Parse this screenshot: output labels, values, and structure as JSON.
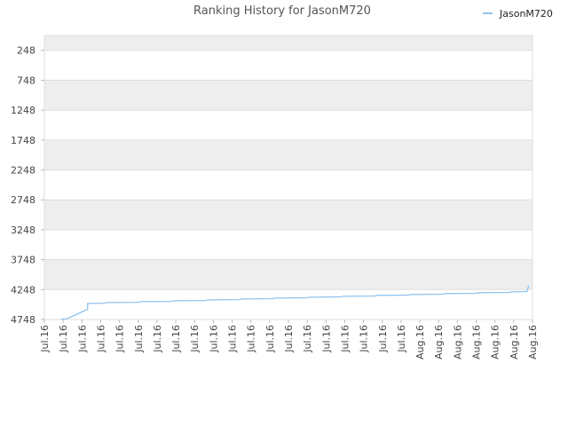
{
  "chart_data": {
    "type": "line",
    "title": "Ranking History for JasonM720",
    "xlabel": "",
    "ylabel": "",
    "y_inverted": true,
    "ylim": [
      4748,
      0
    ],
    "y_ticks": [
      248,
      748,
      1248,
      1748,
      2248,
      2748,
      3248,
      3748,
      4248,
      4748
    ],
    "x_tick_labels": [
      "Jul.16",
      "Jul.16",
      "Jul.16",
      "Jul.16",
      "Jul.16",
      "Jul.16",
      "Jul.16",
      "Jul.16",
      "Jul.16",
      "Jul.16",
      "Jul.16",
      "Jul.16",
      "Jul.16",
      "Jul.16",
      "Jul.16",
      "Jul.16",
      "Jul.16",
      "Jul.16",
      "Jul.16",
      "Jul.16",
      "Aug.16",
      "Aug.16",
      "Aug.16",
      "Aug.16",
      "Aug.16",
      "Aug.16",
      "Aug.16"
    ],
    "grid": true,
    "legend_position": "top-right",
    "series": [
      {
        "name": "JasonM720",
        "color": "#90c4ee",
        "points": [
          [
            0.9,
            4740
          ],
          [
            1.2,
            4735
          ],
          [
            1.6,
            4680
          ],
          [
            2.0,
            4620
          ],
          [
            2.2,
            4590
          ],
          [
            2.3,
            4580
          ],
          [
            2.3,
            4480
          ],
          [
            3.2,
            4475
          ],
          [
            3.3,
            4465
          ],
          [
            5.0,
            4460
          ],
          [
            5.1,
            4450
          ],
          [
            6.8,
            4445
          ],
          [
            6.9,
            4435
          ],
          [
            8.6,
            4430
          ],
          [
            8.7,
            4420
          ],
          [
            10.4,
            4415
          ],
          [
            10.5,
            4405
          ],
          [
            12.2,
            4400
          ],
          [
            12.3,
            4390
          ],
          [
            14.0,
            4385
          ],
          [
            14.1,
            4375
          ],
          [
            15.8,
            4370
          ],
          [
            15.9,
            4360
          ],
          [
            17.6,
            4355
          ],
          [
            17.7,
            4345
          ],
          [
            19.4,
            4340
          ],
          [
            19.5,
            4330
          ],
          [
            21.2,
            4325
          ],
          [
            21.3,
            4315
          ],
          [
            23.0,
            4310
          ],
          [
            23.1,
            4300
          ],
          [
            24.8,
            4295
          ],
          [
            24.9,
            4285
          ],
          [
            25.7,
            4280
          ],
          [
            25.75,
            4235
          ],
          [
            25.8,
            4180
          ]
        ]
      }
    ]
  }
}
